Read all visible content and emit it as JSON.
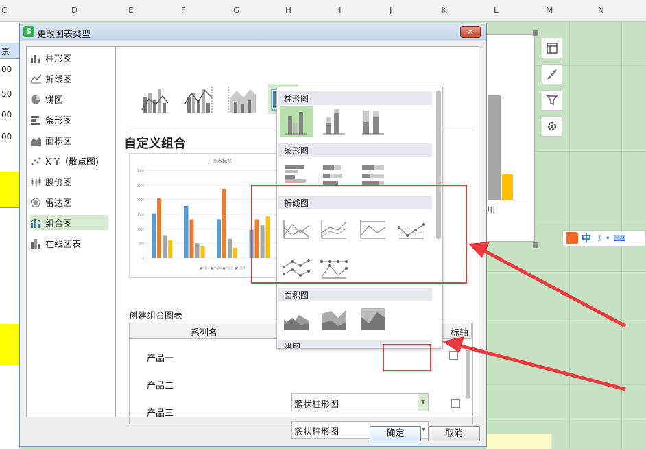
{
  "spreadsheet": {
    "columns": [
      "C",
      "D",
      "E",
      "F",
      "G",
      "H",
      "I",
      "J",
      "K",
      "L",
      "M",
      "N"
    ],
    "left_cells": [
      "京",
      "00",
      "50",
      "00",
      "00"
    ],
    "chart_label": "川"
  },
  "dialog": {
    "title": "更改图表类型",
    "close": "✕",
    "nav": [
      "柱形图",
      "折线图",
      "饼图",
      "条形图",
      "面积图",
      "X Y（散点图)",
      "股价图",
      "雷达图",
      "组合图",
      "在线图表"
    ],
    "selected_nav": "组合图",
    "custom_title": "自定义组合",
    "preview": {
      "title": "图表标题",
      "ylabels": [
        "3000",
        "2500",
        "2000",
        "1500",
        "1000",
        "500",
        "0"
      ],
      "legend": "■产品一 ■产品二 ■产品三 ■产品四"
    },
    "create_label": "创建组合图表",
    "table_headers": {
      "name": "系列名",
      "axis": "标轴"
    },
    "series": [
      {
        "name": "产品一",
        "type": ""
      },
      {
        "name": "产品二",
        "type": "簇状柱形图"
      },
      {
        "name": "产品三",
        "type": "簇状柱形图"
      }
    ],
    "ok": "确定",
    "cancel": "取消"
  },
  "dropdown": {
    "sections": [
      "柱形图",
      "条形图",
      "折线图",
      "面积图",
      "饼图"
    ]
  },
  "ime": {
    "label": "中"
  },
  "colors": {
    "accent_red": "#e8393f",
    "selected_green": "#b7dfac",
    "wps_green": "#2db14a"
  }
}
